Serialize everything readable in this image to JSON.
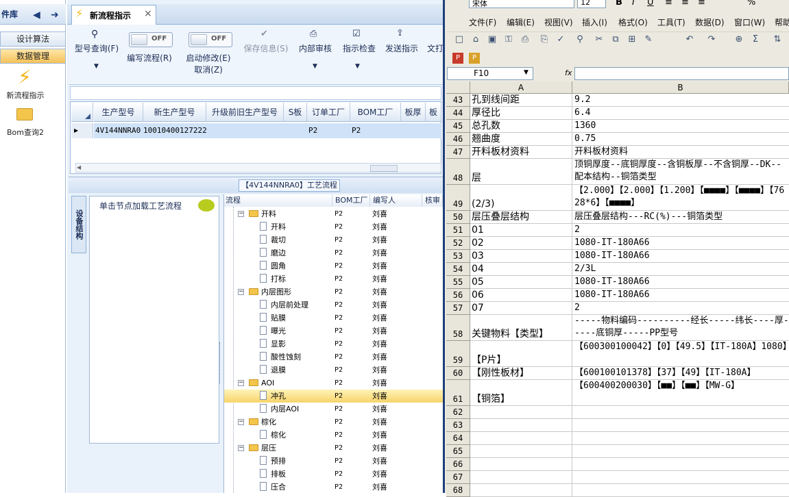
{
  "nav": {
    "title": "件库",
    "items": [
      {
        "label": "设计算法",
        "active": false
      },
      {
        "label": "数据管理",
        "active": true
      }
    ],
    "shortcuts": [
      {
        "label": "新流程指示",
        "icon": "lightning-icon"
      },
      {
        "label": "Bom查询2",
        "icon": "folder-icon"
      }
    ]
  },
  "tab": {
    "title": "新流程指示",
    "close": "×"
  },
  "ribbon": {
    "buttons": [
      {
        "label": "型号查询(F)",
        "icon": "search-icon"
      },
      {
        "label": "编写流程(R)",
        "toggle": "OFF"
      },
      {
        "label": "启动修改(E)",
        "sub": "取消(Z)",
        "toggle": "OFF"
      },
      {
        "label": "保存信息(S)",
        "icon": "check-icon",
        "disabled": true
      },
      {
        "label": "内部审核",
        "icon": "printer-icon"
      },
      {
        "label": "指示检查",
        "icon": "checkbox-icon"
      },
      {
        "label": "发送指示",
        "icon": "upload-icon"
      },
      {
        "label": "文打",
        "icon": "export-icon"
      }
    ]
  },
  "grid": {
    "headers": [
      "生产型号",
      "新生产型号",
      "升级前旧生产型号",
      "S板",
      "订单工厂",
      "BOM工厂",
      "板厚",
      "板"
    ],
    "row": [
      "4V144NNRA0",
      "10010400127222",
      "",
      "",
      "P2",
      "P2",
      "",
      ""
    ]
  },
  "flow": {
    "title": "【4V144NNRA0】工艺流程",
    "side_tab": "设备结构",
    "hint": "单击节点加载工艺流程",
    "columns": [
      "流程",
      "BOM工厂",
      "编写人",
      "核审"
    ],
    "rows": [
      {
        "name": "开料",
        "folder": true,
        "level": 0,
        "bom": "P2",
        "writer": "刘喜"
      },
      {
        "name": "开料",
        "folder": false,
        "level": 1,
        "bom": "P2",
        "writer": "刘喜"
      },
      {
        "name": "裁切",
        "folder": false,
        "level": 1,
        "bom": "P2",
        "writer": "刘喜"
      },
      {
        "name": "磨边",
        "folder": false,
        "level": 1,
        "bom": "P2",
        "writer": "刘喜"
      },
      {
        "name": "圆角",
        "folder": false,
        "level": 1,
        "bom": "P2",
        "writer": "刘喜"
      },
      {
        "name": "打标",
        "folder": false,
        "level": 1,
        "bom": "P2",
        "writer": "刘喜"
      },
      {
        "name": "内层图形",
        "folder": true,
        "level": 0,
        "bom": "P2",
        "writer": "刘喜"
      },
      {
        "name": "内层前处理",
        "folder": false,
        "level": 1,
        "bom": "P2",
        "writer": "刘喜"
      },
      {
        "name": "贴膜",
        "folder": false,
        "level": 1,
        "bom": "P2",
        "writer": "刘喜"
      },
      {
        "name": "曝光",
        "folder": false,
        "level": 1,
        "bom": "P2",
        "writer": "刘喜"
      },
      {
        "name": "显影",
        "folder": false,
        "level": 1,
        "bom": "P2",
        "writer": "刘喜"
      },
      {
        "name": "酸性蚀刻",
        "folder": false,
        "level": 1,
        "bom": "P2",
        "writer": "刘喜"
      },
      {
        "name": "退膜",
        "folder": false,
        "level": 1,
        "bom": "P2",
        "writer": "刘喜"
      },
      {
        "name": "AOI",
        "folder": true,
        "level": 0,
        "bom": "P2",
        "writer": "刘喜"
      },
      {
        "name": "冲孔",
        "folder": false,
        "level": 1,
        "bom": "P2",
        "writer": "刘喜",
        "selected": true
      },
      {
        "name": "内层AOI",
        "folder": false,
        "level": 1,
        "bom": "P2",
        "writer": "刘喜"
      },
      {
        "name": "棕化",
        "folder": true,
        "level": 0,
        "bom": "P2",
        "writer": "刘喜"
      },
      {
        "name": "棕化",
        "folder": false,
        "level": 1,
        "bom": "P2",
        "writer": "刘喜"
      },
      {
        "name": "层压",
        "folder": true,
        "level": 0,
        "bom": "P2",
        "writer": "刘喜"
      },
      {
        "name": "预排",
        "folder": false,
        "level": 1,
        "bom": "P2",
        "writer": "刘喜"
      },
      {
        "name": "排板",
        "folder": false,
        "level": 1,
        "bom": "P2",
        "writer": "刘喜"
      },
      {
        "name": "压合",
        "folder": false,
        "level": 1,
        "bom": "P2",
        "writer": "刘喜"
      }
    ]
  },
  "excel": {
    "font": "宋体",
    "size": "12",
    "menus": [
      "文件(F)",
      "编辑(E)",
      "视图(V)",
      "插入(I)",
      "格式(O)",
      "工具(T)",
      "数据(D)",
      "窗口(W)",
      "帮助"
    ],
    "namebox": "F10",
    "fx": "fx",
    "columns": [
      "A",
      "B"
    ],
    "rows": [
      {
        "n": "43",
        "a": "孔到线间距",
        "b": "9.2"
      },
      {
        "n": "44",
        "a": "厚径比",
        "b": "6.4"
      },
      {
        "n": "45",
        "a": "总孔数",
        "b": "1360"
      },
      {
        "n": "46",
        "a": "翘曲度",
        "b": "0.75"
      },
      {
        "n": "47",
        "a": "开料板材资料",
        "b": "开料板材资料"
      },
      {
        "n": "48",
        "a": "层",
        "b": "顶铜厚度--底铜厚度--含铜板厚--不含铜厚--DK--配本结构--铜箔类型"
      },
      {
        "n": "49",
        "a": "(2/3)",
        "b": "【2.000】【2.000】【1.200】【■■■■】【■■■■】【7628*6】【■■■■】"
      },
      {
        "n": "50",
        "a": "层压叠层结构",
        "b": "层压叠层结构---RC(%)---铜箔类型"
      },
      {
        "n": "51",
        "a": "01",
        "b": "2"
      },
      {
        "n": "52",
        "a": "02",
        "b": "1080-IT-180A66"
      },
      {
        "n": "53",
        "a": "03",
        "b": "1080-IT-180A66"
      },
      {
        "n": "54",
        "a": "04",
        "b": "2/3L"
      },
      {
        "n": "55",
        "a": "05",
        "b": "1080-IT-180A66"
      },
      {
        "n": "56",
        "a": "06",
        "b": "1080-IT-180A66"
      },
      {
        "n": "57",
        "a": "07",
        "b": "2"
      },
      {
        "n": "58",
        "a": "关键物料【类型】",
        "b": "-----物料编码----------经长-----纬长----厚-----底铜厚-----PP型号"
      },
      {
        "n": "59",
        "a": "【P片】",
        "b": "【600300100042】【0】【49.5】【IT-180A】1080】"
      },
      {
        "n": "60",
        "a": "【刚性板材】",
        "b": "【600100101378】【37】【49】【IT-180A】"
      },
      {
        "n": "61",
        "a": "【铜箔】",
        "b": "【600400200030】【■■】【■■】【MW-G】"
      },
      {
        "n": "62",
        "a": "",
        "b": ""
      },
      {
        "n": "63",
        "a": "",
        "b": ""
      },
      {
        "n": "64",
        "a": "",
        "b": ""
      },
      {
        "n": "65",
        "a": "",
        "b": ""
      },
      {
        "n": "66",
        "a": "",
        "b": ""
      },
      {
        "n": "67",
        "a": "",
        "b": ""
      },
      {
        "n": "68",
        "a": "",
        "b": ""
      }
    ]
  }
}
